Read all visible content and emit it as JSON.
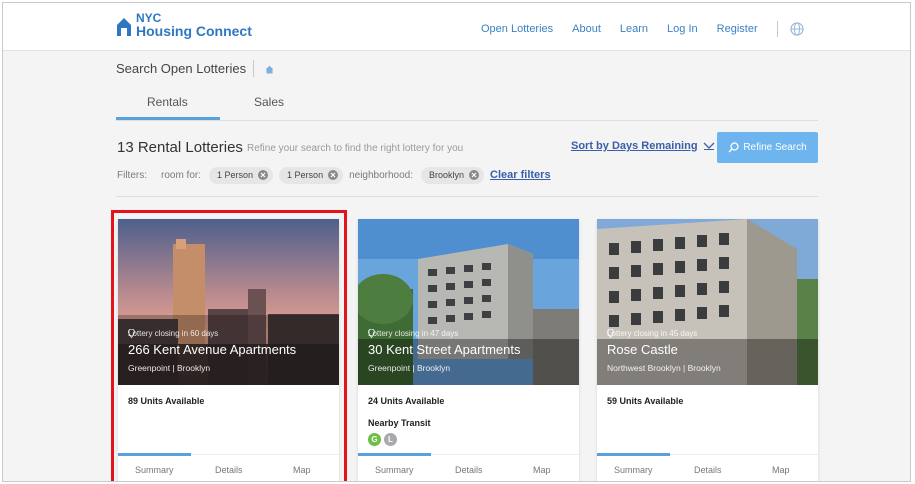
{
  "brand": {
    "line1": "NYC",
    "line2": "Housing Connect"
  },
  "nav": {
    "items": [
      "Open Lotteries",
      "About",
      "Learn",
      "Log In",
      "Register"
    ]
  },
  "search": {
    "title": "Search Open Lotteries",
    "tabs": [
      "Rentals",
      "Sales"
    ],
    "active_tab": "Rentals"
  },
  "results": {
    "count": "13 Rental Lotteries",
    "hint": "Refine your search to find the right lottery for you",
    "sort_label": "Sort by Days Remaining",
    "refine_label": "Refine Search"
  },
  "filters": {
    "label": "Filters:",
    "room_key": "room for:",
    "chips_room": [
      "1 Person",
      "1 Person"
    ],
    "neighborhood_key": "neighborhood:",
    "chip_neighborhood": "Brooklyn",
    "clear": "Clear filters"
  },
  "cards": [
    {
      "closing": "Lottery closing in 60 days",
      "name": "266 Kent Avenue Apartments",
      "location": "Greenpoint | Brooklyn",
      "units": "89 Units Available",
      "tabs": [
        "Summary",
        "Details",
        "Map"
      ]
    },
    {
      "closing": "Lottery closing in 47 days",
      "name": "30 Kent Street Apartments",
      "location": "Greenpoint | Brooklyn",
      "units": "24 Units Available",
      "transit_label": "Nearby Transit",
      "trains": [
        "G",
        "L"
      ],
      "tabs": [
        "Summary",
        "Details",
        "Map"
      ]
    },
    {
      "closing": "Lottery closing in 45 days",
      "name": "Rose Castle",
      "location": "Northwest Brooklyn | Brooklyn",
      "units": "59 Units Available",
      "tabs": [
        "Summary",
        "Details",
        "Map"
      ]
    }
  ],
  "colors": {
    "brand": "#2e78c2",
    "accent": "#6eb4ef",
    "highlight": "#e3121b",
    "train_g": "#6cbe45",
    "train_l": "#a7a9ac"
  },
  "icons": [
    "house-logo-icon",
    "globe-icon",
    "home-icon",
    "chevron-down-icon",
    "search-icon",
    "close-circle-icon",
    "location-pin-icon"
  ]
}
